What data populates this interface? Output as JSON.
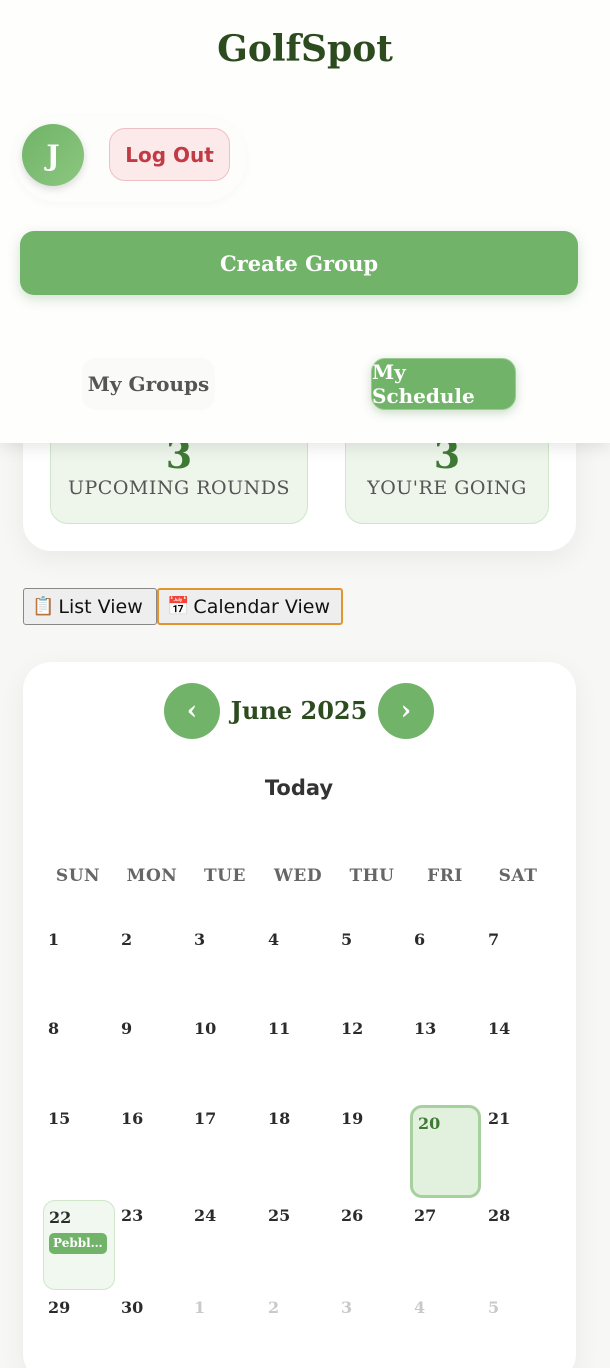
{
  "app": {
    "title": "GolfSpot"
  },
  "user": {
    "initial": "J",
    "logout_label": "Log Out"
  },
  "actions": {
    "create_group_label": "Create Group"
  },
  "tabs": [
    {
      "label": "My Groups",
      "active": false
    },
    {
      "label": "My Schedule",
      "active": true
    }
  ],
  "stats": {
    "upcoming": {
      "value": "3",
      "label": "UPCOMING ROUNDS"
    },
    "going": {
      "value": "3",
      "label": "YOU'RE GOING"
    }
  },
  "view_toggle": {
    "list_icon": "📋",
    "list_label": "List View",
    "calendar_icon": "📅",
    "calendar_label": "Calendar View",
    "selected": "calendar"
  },
  "calendar": {
    "month_label": "June 2025",
    "prev_label": "‹",
    "next_label": "›",
    "today_label": "Today",
    "weekdays": [
      "SUN",
      "MON",
      "TUE",
      "WED",
      "THU",
      "FRI",
      "SAT"
    ],
    "weeks": [
      [
        "1",
        "2",
        "3",
        "4",
        "5",
        "6",
        "7"
      ],
      [
        "8",
        "9",
        "10",
        "11",
        "12",
        "13",
        "14"
      ],
      [
        "15",
        "16",
        "17",
        "18",
        "19",
        "20",
        "21"
      ],
      [
        "22",
        "23",
        "24",
        "25",
        "26",
        "27",
        "28"
      ],
      [
        "29",
        "30",
        "1",
        "2",
        "3",
        "4",
        "5"
      ]
    ],
    "today_day": "20",
    "event": {
      "day": "22",
      "label": "Pebbl…"
    }
  },
  "colors": {
    "accent": "#72b36a",
    "brand_text": "#2c4b1e",
    "danger": "#c13a44"
  }
}
